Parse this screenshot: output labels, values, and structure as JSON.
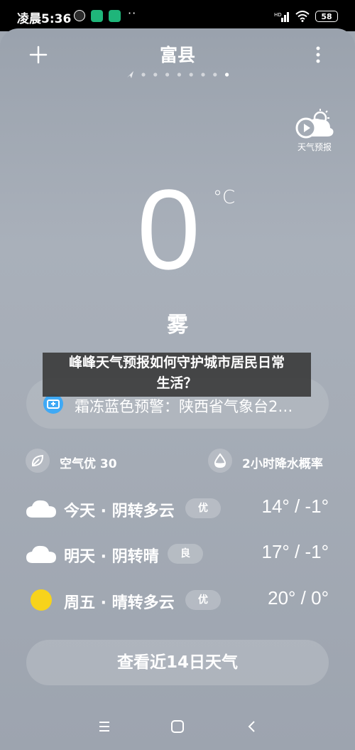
{
  "status_bar": {
    "time": "凌晨5:36",
    "battery": "58",
    "overflow": "··"
  },
  "header": {
    "city": "富县",
    "page_count": 8,
    "active_page": 8
  },
  "forecast_video": {
    "label": "天气预报"
  },
  "current": {
    "temperature": "0",
    "unit": "°C",
    "condition": "雾"
  },
  "warning": {
    "text": "霜冻蓝色预警：陕西省气象台2…"
  },
  "overlay": {
    "line1": "峰峰天气预报如何守护城市居民日常",
    "line2": "生活？"
  },
  "indices": {
    "air_quality": "空气优 30",
    "rain_probability": "2小时降水概率"
  },
  "forecast": [
    {
      "label": "今天 · 阴转多云",
      "badge": "优",
      "temps": "14° / -1°",
      "icon": "cloud-icon"
    },
    {
      "label": "明天 · 阴转晴",
      "badge": "良",
      "temps": "17° / -1°",
      "icon": "cloud-icon"
    },
    {
      "label": "周五 · 晴转多云",
      "badge": "优",
      "temps": "20° / 0°",
      "icon": "sun-icon"
    }
  ],
  "fourteen_day_button": "查看近14日天气",
  "colors": {
    "background": "#a5acb6",
    "status_icon_green": "#1fb57a",
    "warning_blue": "#3fa9f5",
    "sun_yellow": "#f7d31b"
  }
}
